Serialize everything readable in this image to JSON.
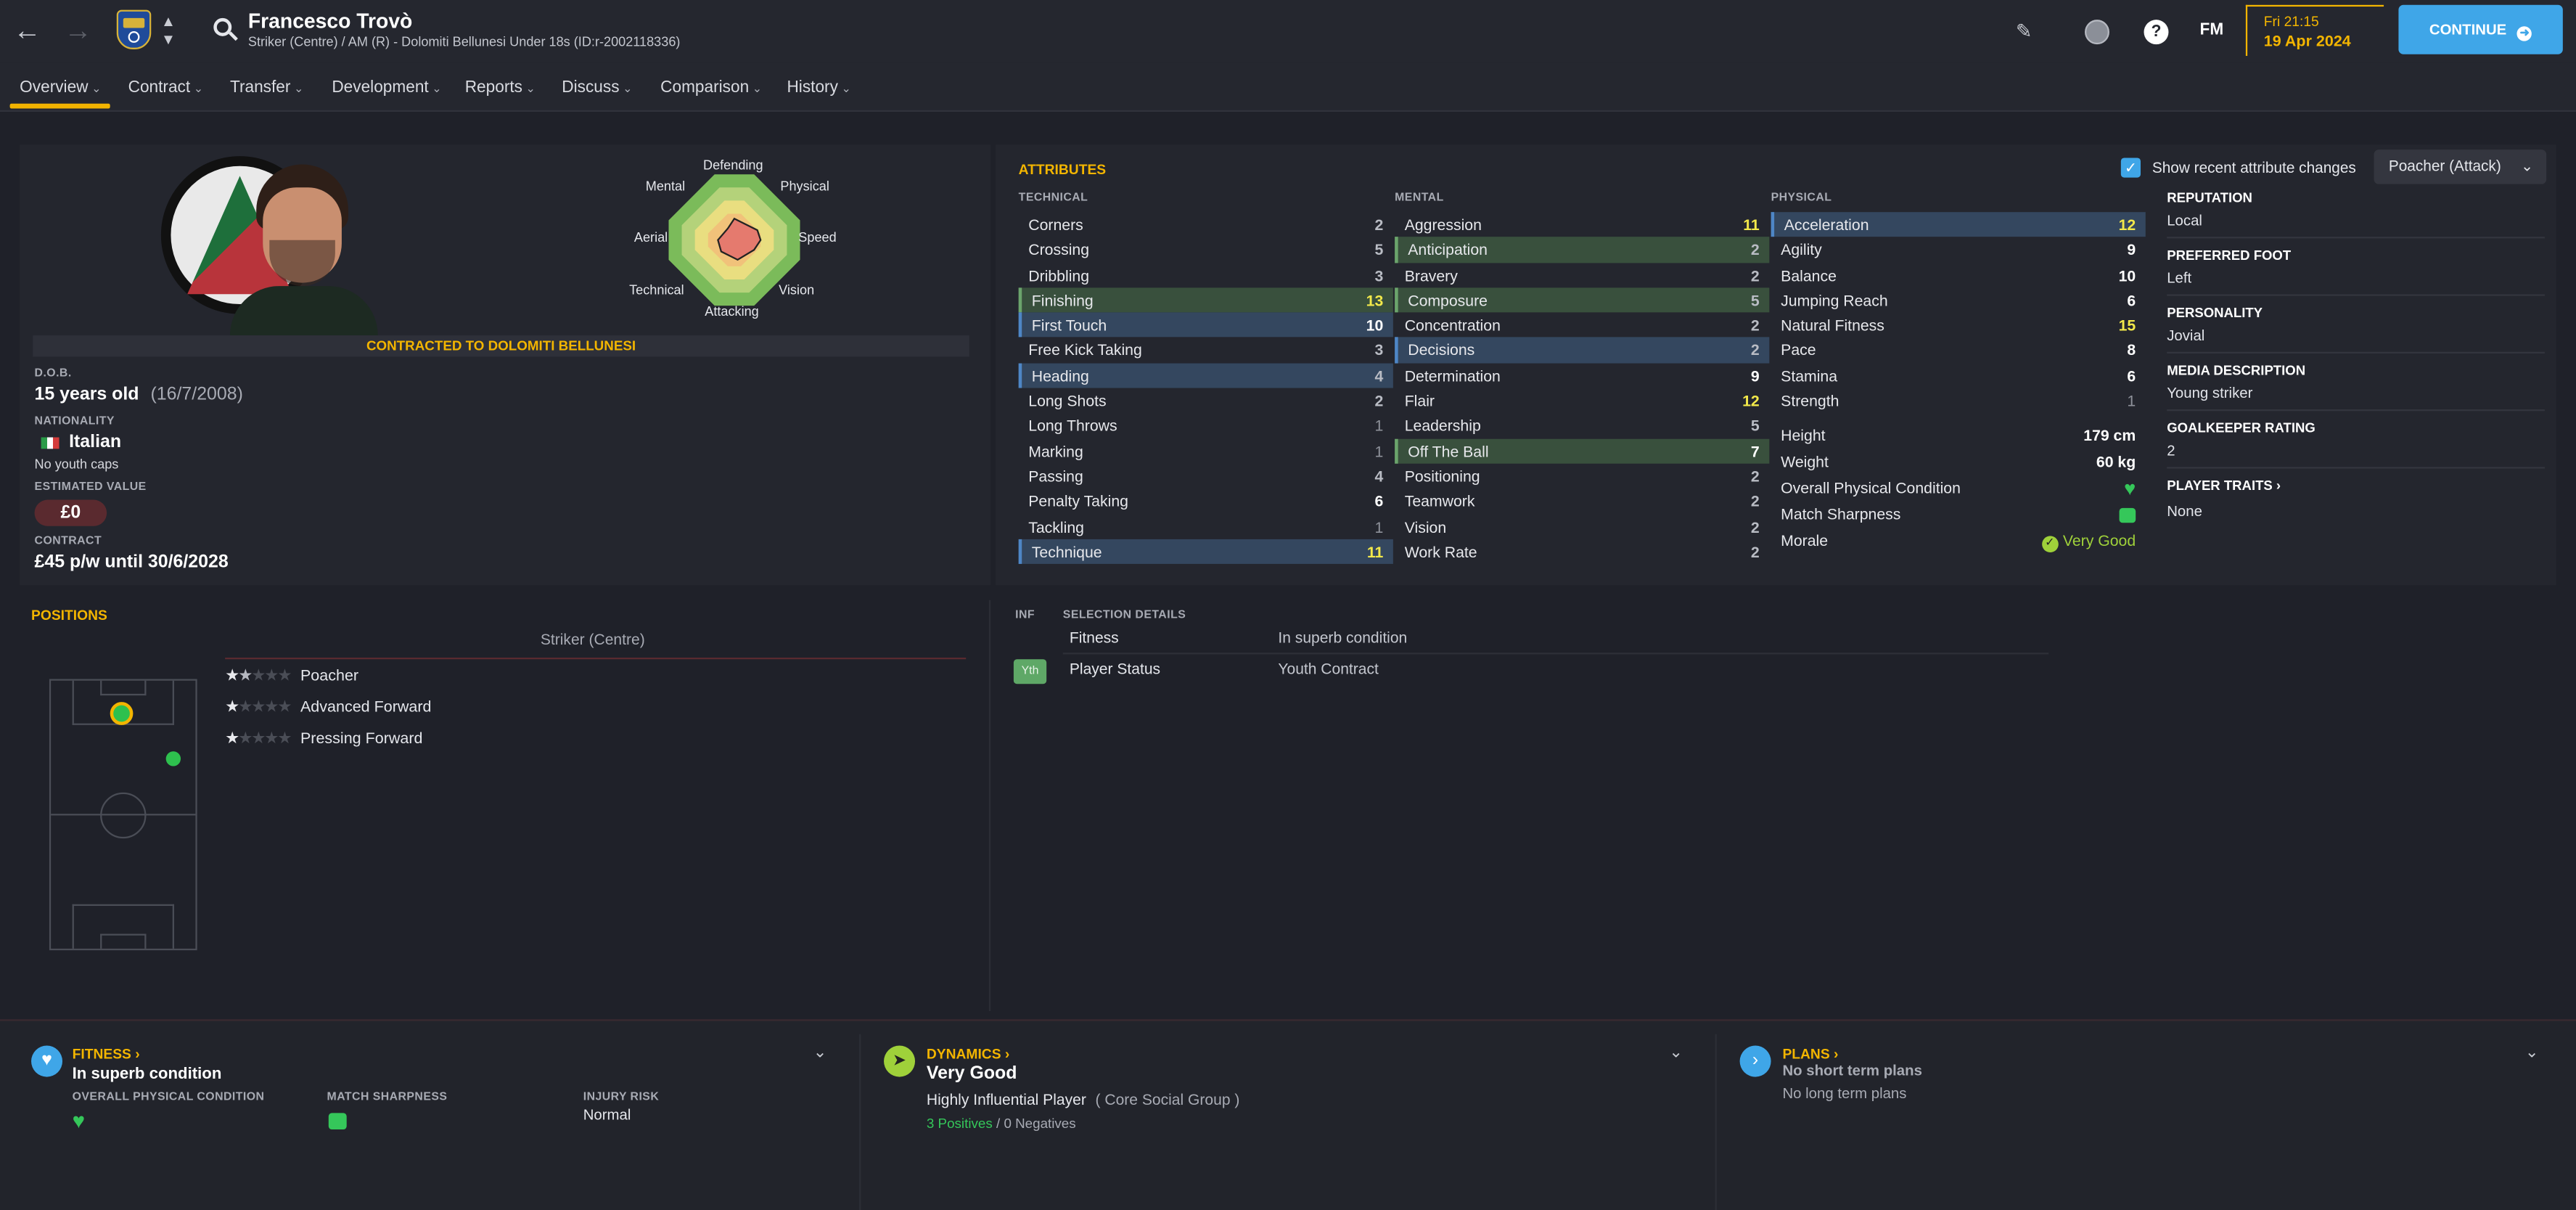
{
  "player": {
    "name": "Francesco Trovò",
    "subtitle": "Striker (Centre) / AM (R) - Dolomiti Bellunesi Under 18s (ID:r-2002118336)"
  },
  "header": {
    "date_time": "Fri 21:15",
    "date": "19 Apr 2024",
    "fm_label": "FM",
    "continue_label": "CONTINUE"
  },
  "nav": {
    "tabs": [
      {
        "label": "Overview"
      },
      {
        "label": "Contract"
      },
      {
        "label": "Transfer"
      },
      {
        "label": "Development"
      },
      {
        "label": "Reports"
      },
      {
        "label": "Discuss"
      },
      {
        "label": "Comparison"
      },
      {
        "label": "History"
      }
    ]
  },
  "profile": {
    "radar": {
      "top": "Defending",
      "top_right": "Physical",
      "right": "Speed",
      "bottom_right": "Vision",
      "bottom": "Attacking",
      "bottom_left": "Technical",
      "left": "Aerial",
      "top_left": "Mental"
    },
    "contract_banner": "CONTRACTED TO DOLOMITI BELLUNESI",
    "dob_label": "D.O.B.",
    "age": "15 years old",
    "dob": "(16/7/2008)",
    "nationality_label": "NATIONALITY",
    "nationality": "Italian",
    "youth_caps": "No youth caps",
    "value_label": "ESTIMATED VALUE",
    "value": "£0",
    "contract_label": "CONTRACT",
    "contract": "£45 p/w until 30/6/2028"
  },
  "attributes": {
    "title": "ATTRIBUTES",
    "show_changes": "Show recent attribute changes",
    "role": "Poacher (Attack)",
    "technical_label": "TECHNICAL",
    "mental_label": "MENTAL",
    "physical_label": "PHYSICAL",
    "technical": [
      {
        "name": "Corners",
        "value": "2",
        "hl": ""
      },
      {
        "name": "Crossing",
        "value": "5",
        "hl": ""
      },
      {
        "name": "Dribbling",
        "value": "3",
        "hl": ""
      },
      {
        "name": "Finishing",
        "value": "13",
        "hl": "green"
      },
      {
        "name": "First Touch",
        "value": "10",
        "hl": "blue"
      },
      {
        "name": "Free Kick Taking",
        "value": "3",
        "hl": ""
      },
      {
        "name": "Heading",
        "value": "4",
        "hl": "blue"
      },
      {
        "name": "Long Shots",
        "value": "2",
        "hl": ""
      },
      {
        "name": "Long Throws",
        "value": "1",
        "hl": ""
      },
      {
        "name": "Marking",
        "value": "1",
        "hl": ""
      },
      {
        "name": "Passing",
        "value": "4",
        "hl": ""
      },
      {
        "name": "Penalty Taking",
        "value": "6",
        "hl": ""
      },
      {
        "name": "Tackling",
        "value": "1",
        "hl": ""
      },
      {
        "name": "Technique",
        "value": "11",
        "hl": "blue"
      }
    ],
    "mental": [
      {
        "name": "Aggression",
        "value": "11",
        "hl": ""
      },
      {
        "name": "Anticipation",
        "value": "2",
        "hl": "green"
      },
      {
        "name": "Bravery",
        "value": "2",
        "hl": ""
      },
      {
        "name": "Composure",
        "value": "5",
        "hl": "green"
      },
      {
        "name": "Concentration",
        "value": "2",
        "hl": ""
      },
      {
        "name": "Decisions",
        "value": "2",
        "hl": "blue"
      },
      {
        "name": "Determination",
        "value": "9",
        "hl": ""
      },
      {
        "name": "Flair",
        "value": "12",
        "hl": ""
      },
      {
        "name": "Leadership",
        "value": "5",
        "hl": ""
      },
      {
        "name": "Off The Ball",
        "value": "7",
        "hl": "green"
      },
      {
        "name": "Positioning",
        "value": "2",
        "hl": ""
      },
      {
        "name": "Teamwork",
        "value": "2",
        "hl": ""
      },
      {
        "name": "Vision",
        "value": "2",
        "hl": ""
      },
      {
        "name": "Work Rate",
        "value": "2",
        "hl": ""
      }
    ],
    "physical": [
      {
        "name": "Acceleration",
        "value": "12",
        "hl": "blue"
      },
      {
        "name": "Agility",
        "value": "9",
        "hl": ""
      },
      {
        "name": "Balance",
        "value": "10",
        "hl": ""
      },
      {
        "name": "Jumping Reach",
        "value": "6",
        "hl": ""
      },
      {
        "name": "Natural Fitness",
        "value": "15",
        "hl": ""
      },
      {
        "name": "Pace",
        "value": "8",
        "hl": ""
      },
      {
        "name": "Stamina",
        "value": "6",
        "hl": ""
      },
      {
        "name": "Strength",
        "value": "1",
        "hl": ""
      }
    ],
    "height_label": "Height",
    "height": "179 cm",
    "weight_label": "Weight",
    "weight": "60 kg",
    "opc_label": "Overall Physical Condition",
    "sharp_label": "Match Sharpness",
    "morale_label": "Morale",
    "morale": "Very Good"
  },
  "side_info": {
    "reputation_label": "REPUTATION",
    "reputation": "Local",
    "foot_label": "PREFERRED FOOT",
    "foot": "Left",
    "personality_label": "PERSONALITY",
    "personality": "Jovial",
    "media_label": "MEDIA DESCRIPTION",
    "media": "Young striker",
    "gk_label": "GOALKEEPER RATING",
    "gk": "2",
    "traits_label": "PLAYER TRAITS",
    "traits": "None"
  },
  "positions": {
    "title": "POSITIONS",
    "main": "Striker (Centre)",
    "roles": [
      {
        "name": "Poacher",
        "stars": 1.5
      },
      {
        "name": "Advanced Forward",
        "stars": 1
      },
      {
        "name": "Pressing Forward",
        "stars": 1
      }
    ]
  },
  "selection": {
    "inf_label": "INF",
    "details_label": "SELECTION DETAILS",
    "fitness_label": "Fitness",
    "fitness": "In superb condition",
    "yth_badge": "Yth",
    "status_label": "Player Status",
    "status": "Youth Contract"
  },
  "bottom": {
    "fitness_title": "FITNESS",
    "fitness_value": "In superb condition",
    "opc_label": "OVERALL PHYSICAL CONDITION",
    "sharp_label": "MATCH SHARPNESS",
    "injury_label": "INJURY RISK",
    "injury": "Normal",
    "dyn_title": "DYNAMICS",
    "dyn_value": "Very Good",
    "influence": "Highly Influential Player",
    "group": "( Core Social Group )",
    "positives": "3 Positives",
    "slash": "/",
    "negatives": "0 Negatives",
    "plans_title": "PLANS",
    "short_plans": "No short term plans",
    "long_plans": "No long term plans"
  },
  "colors": {
    "accent": "#f3b500",
    "continue": "#3fa6e8",
    "green": "#35c75a"
  }
}
